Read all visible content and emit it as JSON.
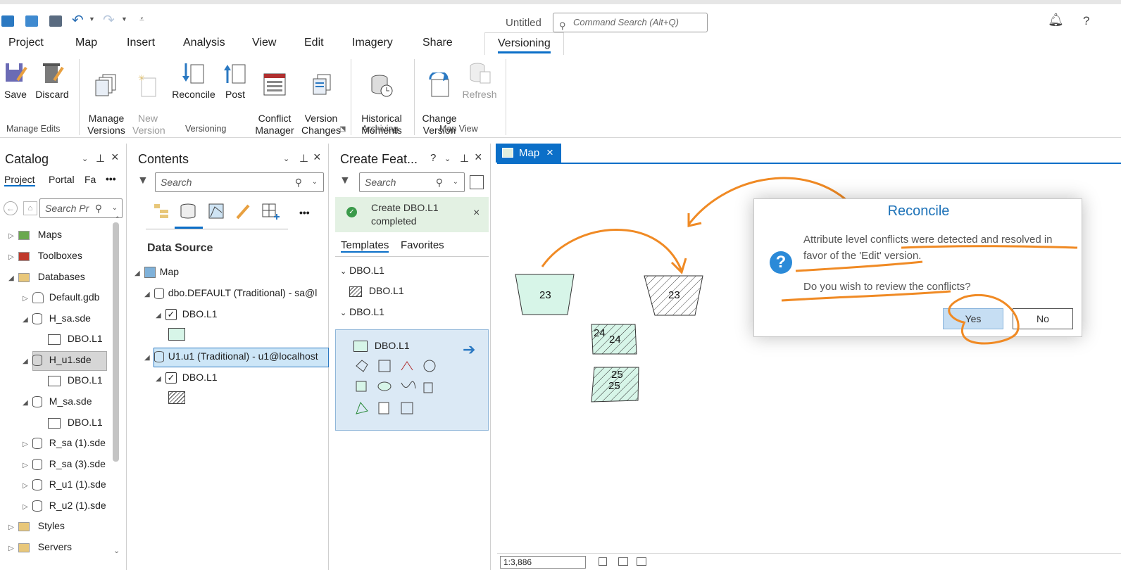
{
  "window": {
    "title": "Untitled",
    "command_search_placeholder": "Command Search (Alt+Q)",
    "help_label": "?"
  },
  "ribbon_tabs": [
    "Project",
    "Map",
    "Insert",
    "Analysis",
    "View",
    "Edit",
    "Imagery",
    "Share",
    "Versioning"
  ],
  "ribbon": {
    "save": "Save",
    "discard": "Discard",
    "manage_edits": "Manage Edits",
    "manage_versions": "Manage\nVersions",
    "new_version": "New\nVersion",
    "reconcile": "Reconcile",
    "post": "Post",
    "conflict_manager": "Conflict\nManager",
    "version_changes": "Version\nChanges",
    "versioning": "Versioning",
    "historical_moments": "Historical\nMoments",
    "archiving": "Archiving",
    "change_version": "Change\nVersion",
    "refresh": "Refresh",
    "map_view": "Map View"
  },
  "catalog": {
    "title": "Catalog",
    "tabs": [
      "Project",
      "Portal",
      "Fa"
    ],
    "more": "•••",
    "search_placeholder": "Search Pr",
    "items": [
      "Maps",
      "Toolboxes",
      "Databases",
      "Default.gdb",
      "H_sa.sde",
      "DBO.L1",
      "H_u1.sde",
      "DBO.L1",
      "M_sa.sde",
      "DBO.L1",
      "R_sa (1).sde",
      "R_sa (3).sde",
      "R_u1 (1).sde",
      "R_u2 (1).sde",
      "Styles",
      "Servers"
    ]
  },
  "contents": {
    "title": "Contents",
    "search_placeholder": "Search",
    "more": "•••",
    "section": "Data Source",
    "map": "Map",
    "default_conn": "dbo.DEFAULT (Traditional) - sa@l",
    "layer1": "DBO.L1",
    "u1_conn": "U1.u1 (Traditional) - u1@localhost",
    "layer2": "DBO.L1"
  },
  "create_features": {
    "title": "Create Feat...",
    "help": "?",
    "search_placeholder": "Search",
    "notice": "Create DBO.L1\ncompleted",
    "tabs": [
      "Templates",
      "Favorites"
    ],
    "group1": "DBO.L1",
    "group1_item": "DBO.L1",
    "group2": "DBO.L1",
    "group2_item": "DBO.L1"
  },
  "map": {
    "tab_label": "Map",
    "labels": [
      "23",
      "23",
      "24",
      "24",
      "25",
      "25"
    ],
    "scale": "1:3,886"
  },
  "dialog": {
    "title": "Reconcile",
    "message": "Attribute level conflicts were detected and resolved in favor of the 'Edit' version.",
    "question": "Do you wish to review the conflicts?",
    "yes": "Yes",
    "no": "No"
  },
  "colors": {
    "accent": "#0b6fc8",
    "annotation": "#f08a24",
    "feature_fill": "#d7f5e8",
    "dialog_title": "#1d72b8"
  }
}
